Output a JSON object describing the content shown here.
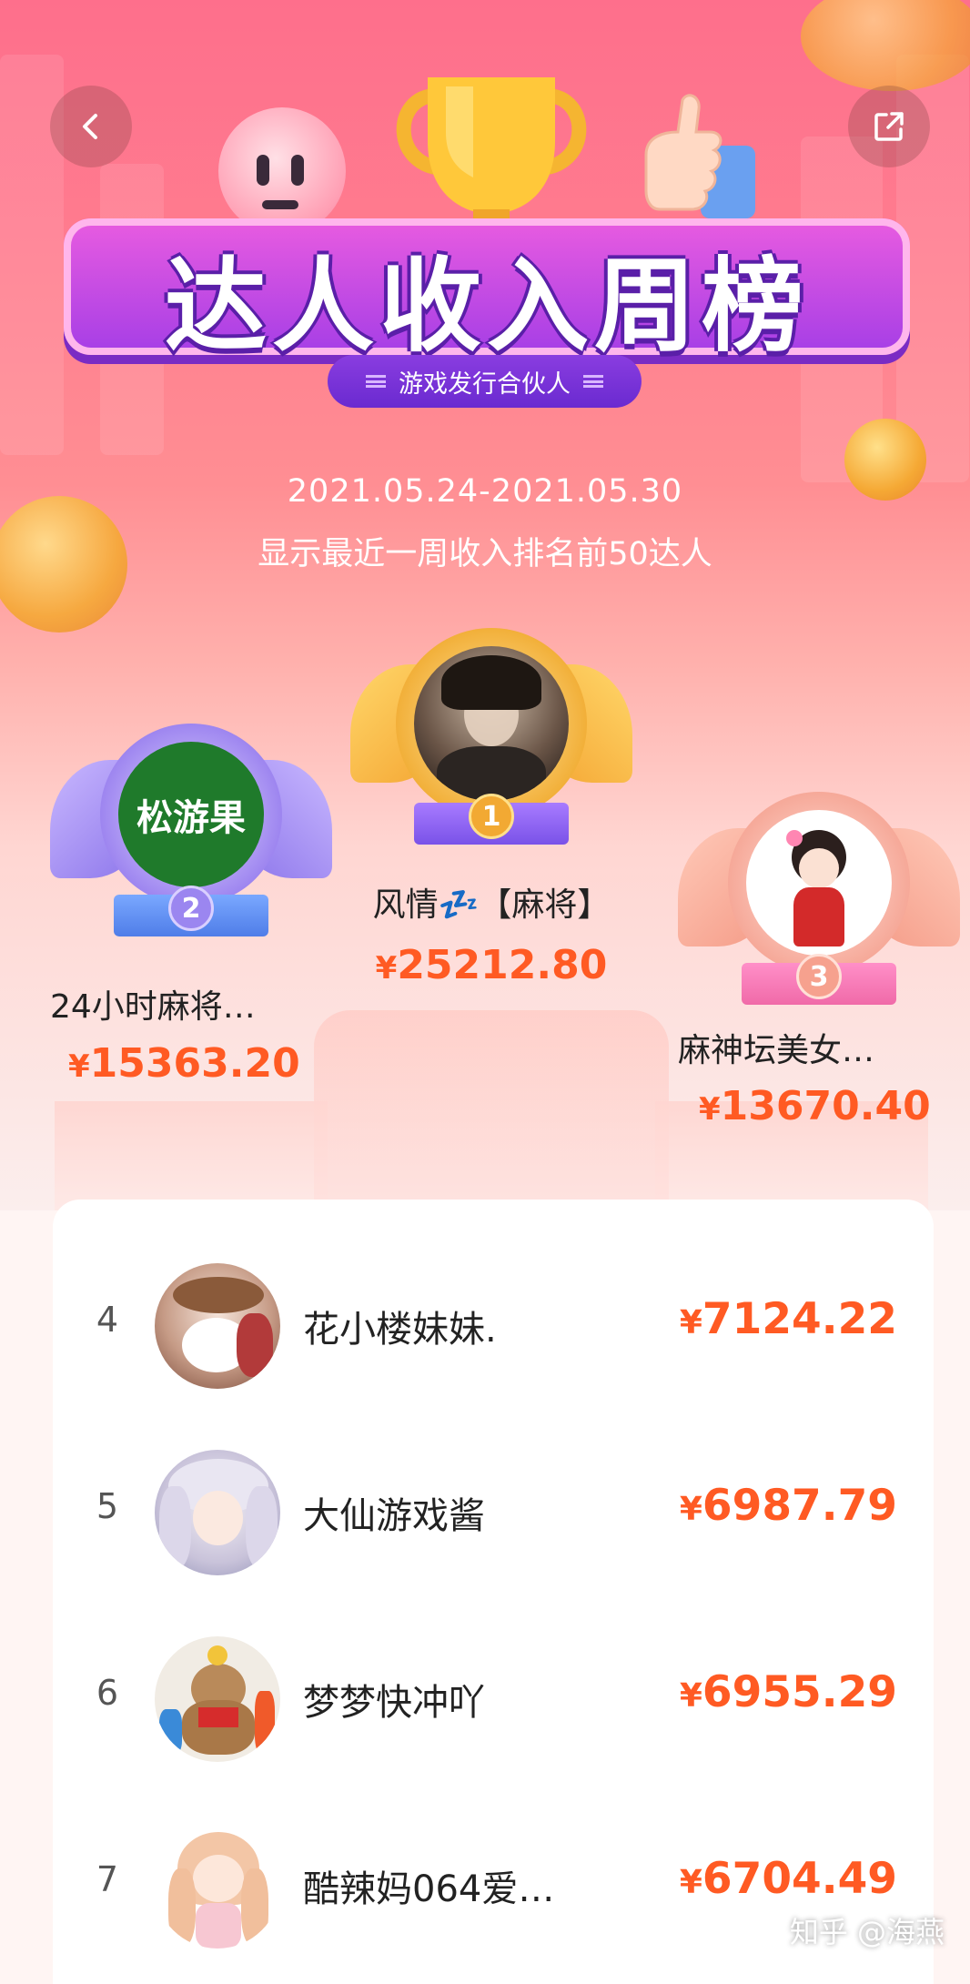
{
  "header": {
    "title": "达人收入周榜",
    "subtitle": "游戏发行合伙人",
    "date_range": "2021.05.24-2021.05.30",
    "note": "显示最近一周收入排名前50达人"
  },
  "podium": [
    {
      "rank": "1",
      "name": "风情💤【麻将】",
      "amount": "25212.80",
      "currency": "¥",
      "logo_text": ""
    },
    {
      "rank": "2",
      "name": "24小时麻将…",
      "amount": "15363.20",
      "currency": "¥",
      "logo_text": "松游果"
    },
    {
      "rank": "3",
      "name": "麻神坛美女…",
      "amount": "13670.40",
      "currency": "¥",
      "logo_text": ""
    }
  ],
  "list": [
    {
      "rank": "4",
      "name": "花小楼妹妹.",
      "amount": "7124.22",
      "currency": "¥"
    },
    {
      "rank": "5",
      "name": "大仙游戏酱",
      "amount": "6987.79",
      "currency": "¥"
    },
    {
      "rank": "6",
      "name": "梦梦快冲吖",
      "amount": "6955.29",
      "currency": "¥"
    },
    {
      "rank": "7",
      "name": "酷辣妈064爱…",
      "amount": "6704.49",
      "currency": "¥"
    }
  ],
  "watermark": "知乎 @海燕",
  "colors": {
    "accent": "#ff5a23",
    "gold": "#f5a935",
    "purple": "#a53ee6",
    "pink": "#fe6f8c"
  }
}
